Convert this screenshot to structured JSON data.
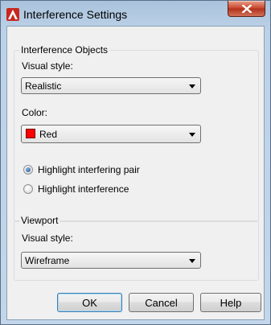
{
  "window": {
    "title": "Interference Settings",
    "icon": "autocad-logo-icon",
    "close_glyph": "x"
  },
  "objects_group": {
    "title": "Interference Objects",
    "visual_style_label": "Visual style:",
    "visual_style_value": "Realistic",
    "color_label": "Color:",
    "color_value": "Red",
    "color_swatch": "#ff0000",
    "radio_pair_label": "Highlight interfering pair",
    "radio_pair_checked": true,
    "radio_interference_label": "Highlight interference",
    "radio_interference_checked": false
  },
  "viewport_group": {
    "title": "Viewport",
    "visual_style_label": "Visual style:",
    "visual_style_value": "Wireframe"
  },
  "buttons": {
    "ok": "OK",
    "cancel": "Cancel",
    "help": "Help"
  }
}
